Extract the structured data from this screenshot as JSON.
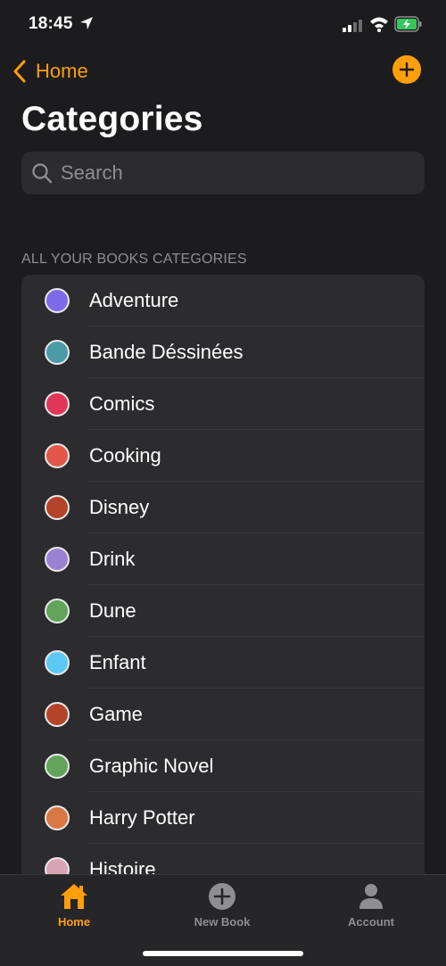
{
  "status_bar": {
    "time": "18:45"
  },
  "nav": {
    "back_label": "Home"
  },
  "page": {
    "title": "Categories"
  },
  "search": {
    "placeholder": "Search",
    "value": ""
  },
  "section": {
    "header": "ALL YOUR BOOKS CATEGORIES"
  },
  "categories": [
    {
      "label": "Adventure",
      "color": "#7d6bea"
    },
    {
      "label": "Bande Déssinées",
      "color": "#4a9aa8"
    },
    {
      "label": "Comics",
      "color": "#e0365a"
    },
    {
      "label": "Cooking",
      "color": "#e2574a"
    },
    {
      "label": "Disney",
      "color": "#b5432a"
    },
    {
      "label": "Drink",
      "color": "#9a82d2"
    },
    {
      "label": "Dune",
      "color": "#62a45a"
    },
    {
      "label": "Enfant",
      "color": "#5bc8f5"
    },
    {
      "label": "Game",
      "color": "#b5432a"
    },
    {
      "label": "Graphic Novel",
      "color": "#62a45a"
    },
    {
      "label": "Harry Potter",
      "color": "#d97843"
    },
    {
      "label": "Histoire",
      "color": "#d8a4b4"
    }
  ],
  "tabs": [
    {
      "label": "Home",
      "icon": "house-icon"
    },
    {
      "label": "New Book",
      "icon": "plus-circle-icon"
    },
    {
      "label": "Account",
      "icon": "person-icon"
    }
  ],
  "colors": {
    "accent": "#ff9f0a",
    "background": "#1c1c1e",
    "grouped_cell": "#2c2c2e"
  }
}
